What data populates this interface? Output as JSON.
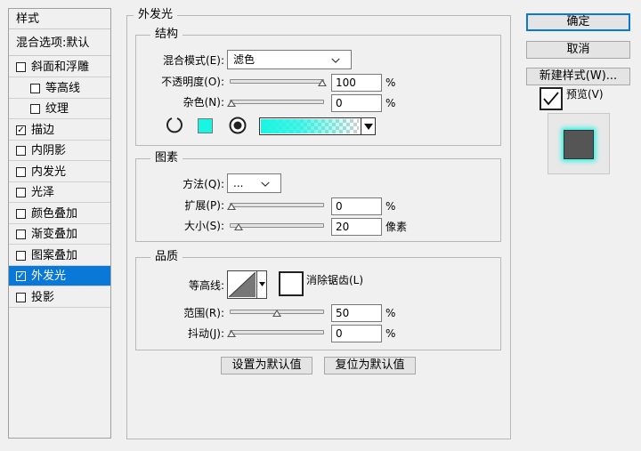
{
  "style_list": {
    "header": "样式",
    "blend_default": "混合选项:默认",
    "items": [
      {
        "label": "斜面和浮雕",
        "checked": false,
        "indent": false
      },
      {
        "label": "等高线",
        "checked": false,
        "indent": true
      },
      {
        "label": "纹理",
        "checked": false,
        "indent": true
      },
      {
        "label": "描边",
        "checked": true,
        "indent": false
      },
      {
        "label": "内阴影",
        "checked": false,
        "indent": false
      },
      {
        "label": "内发光",
        "checked": false,
        "indent": false
      },
      {
        "label": "光泽",
        "checked": false,
        "indent": false
      },
      {
        "label": "颜色叠加",
        "checked": false,
        "indent": false
      },
      {
        "label": "渐变叠加",
        "checked": false,
        "indent": false
      },
      {
        "label": "图案叠加",
        "checked": false,
        "indent": false
      },
      {
        "label": "外发光",
        "checked": true,
        "indent": false,
        "selected": true
      },
      {
        "label": "投影",
        "checked": false,
        "indent": false
      }
    ],
    "check_glyph": "☑"
  },
  "panel": {
    "title": "外发光",
    "structure": {
      "title": "结构",
      "blend_mode_label": "混合模式(E):",
      "blend_mode_value": "滤色",
      "opacity_label": "不透明度(O):",
      "opacity_value": "100",
      "opacity_level": 1.0,
      "noise_label": "杂色(N):",
      "noise_value": "0",
      "noise_level": 0.0,
      "pct": "%",
      "color_swatch": "#19f5e3",
      "gradient_from": "#19f5e3"
    },
    "elements": {
      "title": "图素",
      "technique_label": "方法(Q):",
      "technique_value": "...",
      "spread_label": "扩展(P):",
      "spread_value": "0",
      "spread_level": 0.0,
      "size_label": "大小(S):",
      "size_value": "20",
      "size_level": 0.08,
      "px_unit": "像素",
      "pct": "%"
    },
    "quality": {
      "title": "品质",
      "contour_label": "等高线:",
      "antialias_label": "消除锯齿(L)",
      "range_label": "范围(R):",
      "range_value": "50",
      "range_level": 0.5,
      "jitter_label": "抖动(J):",
      "jitter_value": "0",
      "jitter_level": 0.0,
      "pct": "%"
    },
    "make_default": "设置为默认值",
    "reset_default": "复位为默认值"
  },
  "right": {
    "ok": "确定",
    "cancel": "取消",
    "new_style": "新建样式(W)...",
    "preview_label": "预览(V)",
    "preview_checked": true,
    "glow_color": "#19f5e3"
  }
}
